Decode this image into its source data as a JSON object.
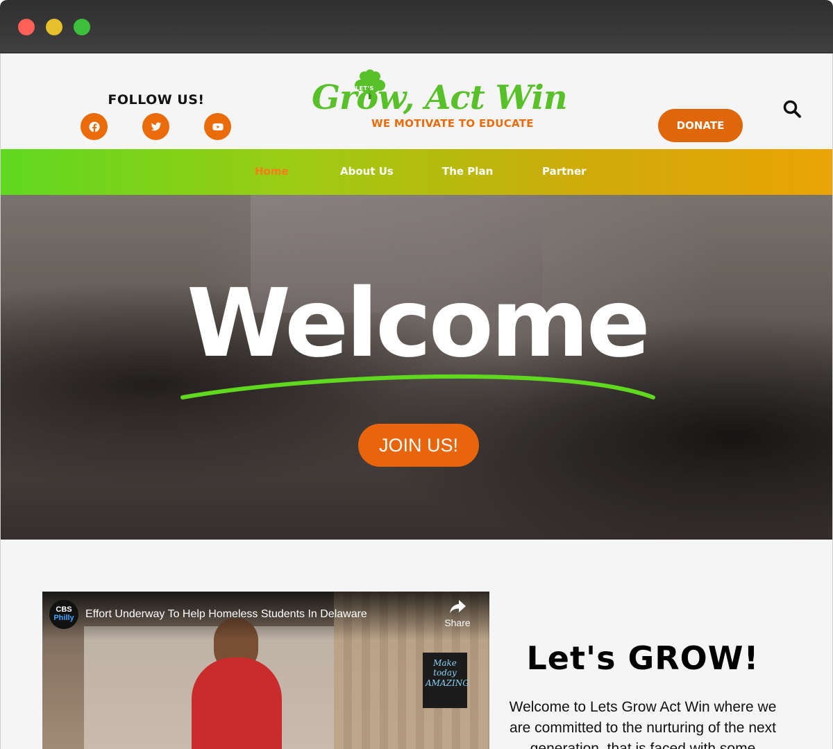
{
  "window": {
    "controls": [
      "close",
      "minimize",
      "zoom"
    ]
  },
  "header": {
    "follow_title": "FOLLOW US!",
    "social": [
      {
        "icon": "facebook-icon"
      },
      {
        "icon": "twitter-icon"
      },
      {
        "icon": "youtube-icon"
      }
    ],
    "logo": {
      "lets": "LET'S",
      "main": "Grow, Act Win",
      "tagline": "WE MOTIVATE TO EDUCATE"
    },
    "donate_label": "DONATE",
    "search_icon": "search-icon"
  },
  "nav": {
    "items": [
      {
        "label": "Home",
        "active": true
      },
      {
        "label": "About Us",
        "active": false
      },
      {
        "label": "The Plan",
        "active": false
      },
      {
        "label": "Partner",
        "active": false
      }
    ]
  },
  "hero": {
    "title": "Welcome",
    "join_label": "JOIN US!"
  },
  "video": {
    "channel": "CBS Philly",
    "channel_line1": "CBS",
    "channel_line2": "Philly",
    "title": "Effort Underway To Help Homeless Students In Delaware",
    "share_label": "Share",
    "poster_text": "Make today AMAZING"
  },
  "content": {
    "heading": "Let's GROW!",
    "intro": "Welcome to Lets Grow Act Win where we are committed to the nurturing of the next generation, that is faced with some"
  },
  "colors": {
    "accent_orange": "#e8650b",
    "brand_green": "#58c12a",
    "nav_gradient_start": "#5fd81f",
    "nav_gradient_end": "#eba405"
  }
}
